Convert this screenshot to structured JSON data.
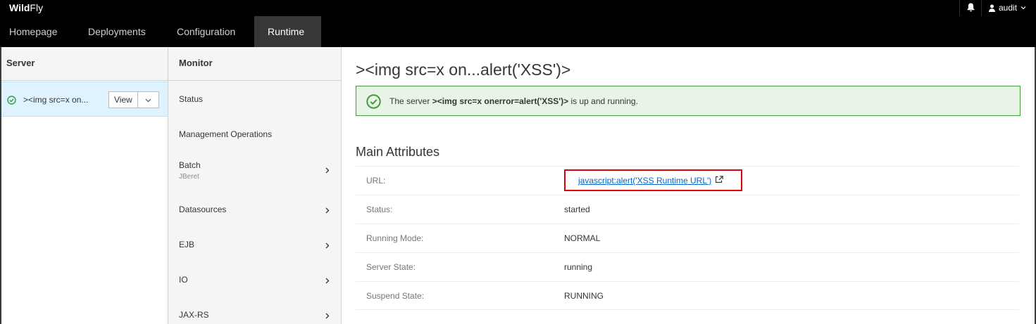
{
  "app": {
    "brand_bold": "Wild",
    "brand_light": "Fly"
  },
  "topbar": {
    "user": "audit",
    "icons": [
      "bell-icon",
      "user-icon",
      "chevron-down-icon"
    ]
  },
  "nav": {
    "tabs": [
      {
        "label": "Homepage"
      },
      {
        "label": "Deployments"
      },
      {
        "label": "Configuration"
      },
      {
        "label": "Runtime",
        "active": true
      }
    ]
  },
  "server_pane": {
    "title": "Server",
    "item": {
      "label": "><img src=x on...",
      "status": "ok",
      "view_label": "View"
    }
  },
  "monitor_pane": {
    "title": "Monitor",
    "items": [
      {
        "label": "Status",
        "sub": ""
      },
      {
        "label": "Management Operations",
        "sub": ""
      },
      {
        "label": "Batch",
        "sub": "JBeret"
      },
      {
        "label": "Datasources",
        "sub": ""
      },
      {
        "label": "EJB",
        "sub": ""
      },
      {
        "label": "IO",
        "sub": ""
      },
      {
        "label": "JAX-RS",
        "sub": ""
      }
    ]
  },
  "main": {
    "title": "><img src=x on...alert('XSS')>",
    "alert": {
      "prefix": "The server ",
      "server": "><img src=x onerror=alert('XSS')>",
      "suffix": " is up and running."
    },
    "section": "Main Attributes",
    "attributes": [
      {
        "key": "URL:",
        "value": "javascript:alert('XSS Runtime URL')"
      },
      {
        "key": "Status:",
        "value": "started"
      },
      {
        "key": "Running Mode:",
        "value": "NORMAL"
      },
      {
        "key": "Server State:",
        "value": "running"
      },
      {
        "key": "Suspend State:",
        "value": "RUNNING"
      }
    ]
  },
  "colors": {
    "accent_link": "#0066cc",
    "success": "#3f9c35",
    "highlight": "#e00000",
    "selected": "#def3ff"
  }
}
